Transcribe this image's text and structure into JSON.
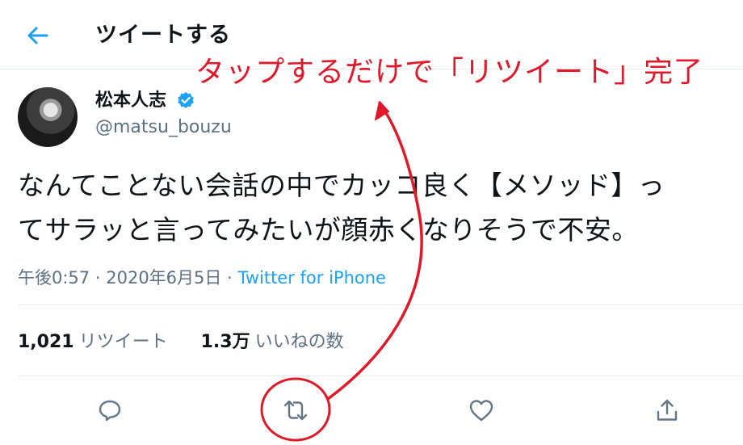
{
  "header": {
    "title": "ツイートする"
  },
  "tweet": {
    "display_name": "松本人志",
    "handle": "@matsu_bouzu",
    "text_line1": "なんてことない会話の中でカッコ良く【メソッド】っ",
    "text_line2": "てサラッと言ってみたいが顔赤くなりそうで不安。",
    "time": "午後0:57",
    "separator": "·",
    "date": "2020年6月5日",
    "source": "Twitter for iPhone"
  },
  "stats": {
    "retweets_count": "1,021",
    "retweets_label": "リツイート",
    "likes_count": "1.3万",
    "likes_label": "いいねの数"
  },
  "annotation": {
    "text": "タップするだけで「リツイート」完了",
    "color": "#e0192a"
  },
  "colors": {
    "accent": "#1da1f2",
    "secondary_text": "#5b7083",
    "icon": "#657786"
  },
  "icons": {
    "back": "arrow-left-icon",
    "verified": "verified-badge-icon",
    "reply": "reply-icon",
    "retweet": "retweet-icon",
    "like": "heart-icon",
    "share": "share-icon"
  }
}
